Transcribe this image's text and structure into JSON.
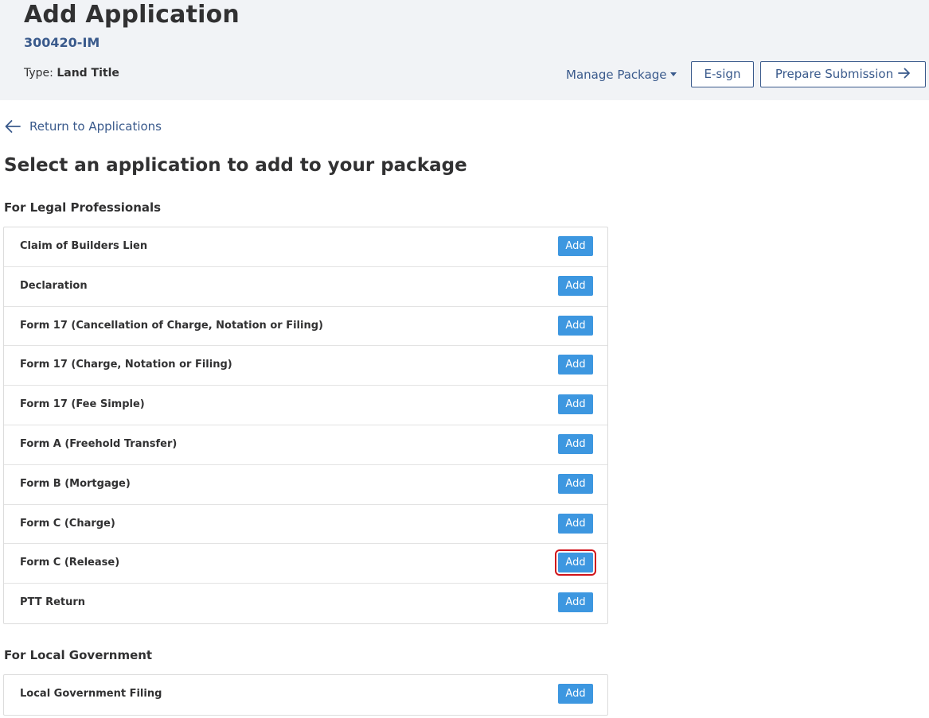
{
  "header": {
    "title": "Add Application",
    "application_id": "300420-IM",
    "type_label": "Type:",
    "type_value": "Land Title",
    "manage_package_label": "Manage Package",
    "esign_label": "E-sign",
    "prepare_submission_label": "Prepare Submission"
  },
  "nav": {
    "return_label": "Return to Applications"
  },
  "main": {
    "heading": "Select an application to add to your package",
    "groups": [
      {
        "title": "For Legal Professionals",
        "items": [
          {
            "label": "Claim of Builders Lien",
            "button": "Add"
          },
          {
            "label": "Declaration",
            "button": "Add"
          },
          {
            "label": "Form 17 (Cancellation of Charge, Notation or Filing)",
            "button": "Add"
          },
          {
            "label": "Form 17 (Charge, Notation or Filing)",
            "button": "Add"
          },
          {
            "label": "Form 17 (Fee Simple)",
            "button": "Add"
          },
          {
            "label": "Form A (Freehold Transfer)",
            "button": "Add"
          },
          {
            "label": "Form B (Mortgage)",
            "button": "Add"
          },
          {
            "label": "Form C (Charge)",
            "button": "Add"
          },
          {
            "label": "Form C (Release)",
            "button": "Add",
            "highlighted": true
          },
          {
            "label": "PTT Return",
            "button": "Add"
          }
        ]
      },
      {
        "title": "For Local Government",
        "items": [
          {
            "label": "Local Government Filing",
            "button": "Add"
          }
        ]
      }
    ]
  },
  "colors": {
    "primary_text": "#313132",
    "link_blue": "#3a5a8c",
    "button_blue": "#3d97e0",
    "header_bg": "#f1f3f6",
    "highlight_red": "#d0131a"
  }
}
